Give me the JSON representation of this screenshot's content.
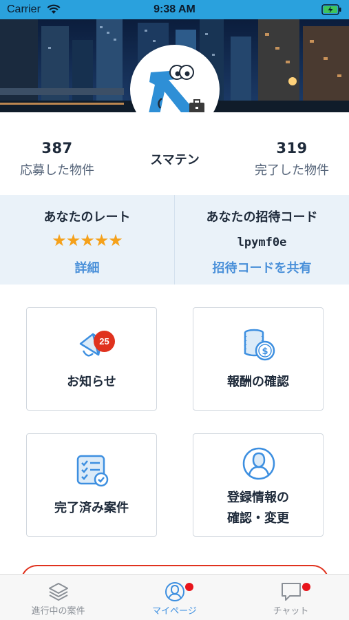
{
  "status_bar": {
    "carrier": "Carrier",
    "time": "9:38 AM"
  },
  "profile": {
    "name": "スマテン"
  },
  "stats": {
    "applied": {
      "value": "387",
      "label": "応募した物件"
    },
    "completed": {
      "value": "319",
      "label": "完了した物件"
    }
  },
  "rate": {
    "title": "あなたのレート",
    "stars_filled": 5,
    "stars_total": 5,
    "stars_text": "★★★★★",
    "link": "詳細"
  },
  "invite": {
    "title": "あなたの招待コード",
    "code": "lpymf0e",
    "link": "招待コードを共有"
  },
  "menu": {
    "notice": {
      "label": "お知らせ",
      "badge": "25"
    },
    "reward": {
      "label": "報酬の確認"
    },
    "done": {
      "label": "完了済み案件"
    },
    "profile": {
      "label_line1": "登録情報の",
      "label_line2": "確認・変更"
    }
  },
  "tabs": [
    {
      "label": "進行中の案件",
      "icon": "layers-icon",
      "active": false
    },
    {
      "label": "マイページ",
      "icon": "person-icon",
      "active": true,
      "dot": true
    },
    {
      "label": "チャット",
      "icon": "chat-icon",
      "active": false,
      "dot": true
    }
  ],
  "colors": {
    "accent": "#3d8fe0",
    "badge": "#e0321e",
    "star": "#f5a11b",
    "panel": "#eaf2f9",
    "status_bar": "#2aa1dd"
  }
}
